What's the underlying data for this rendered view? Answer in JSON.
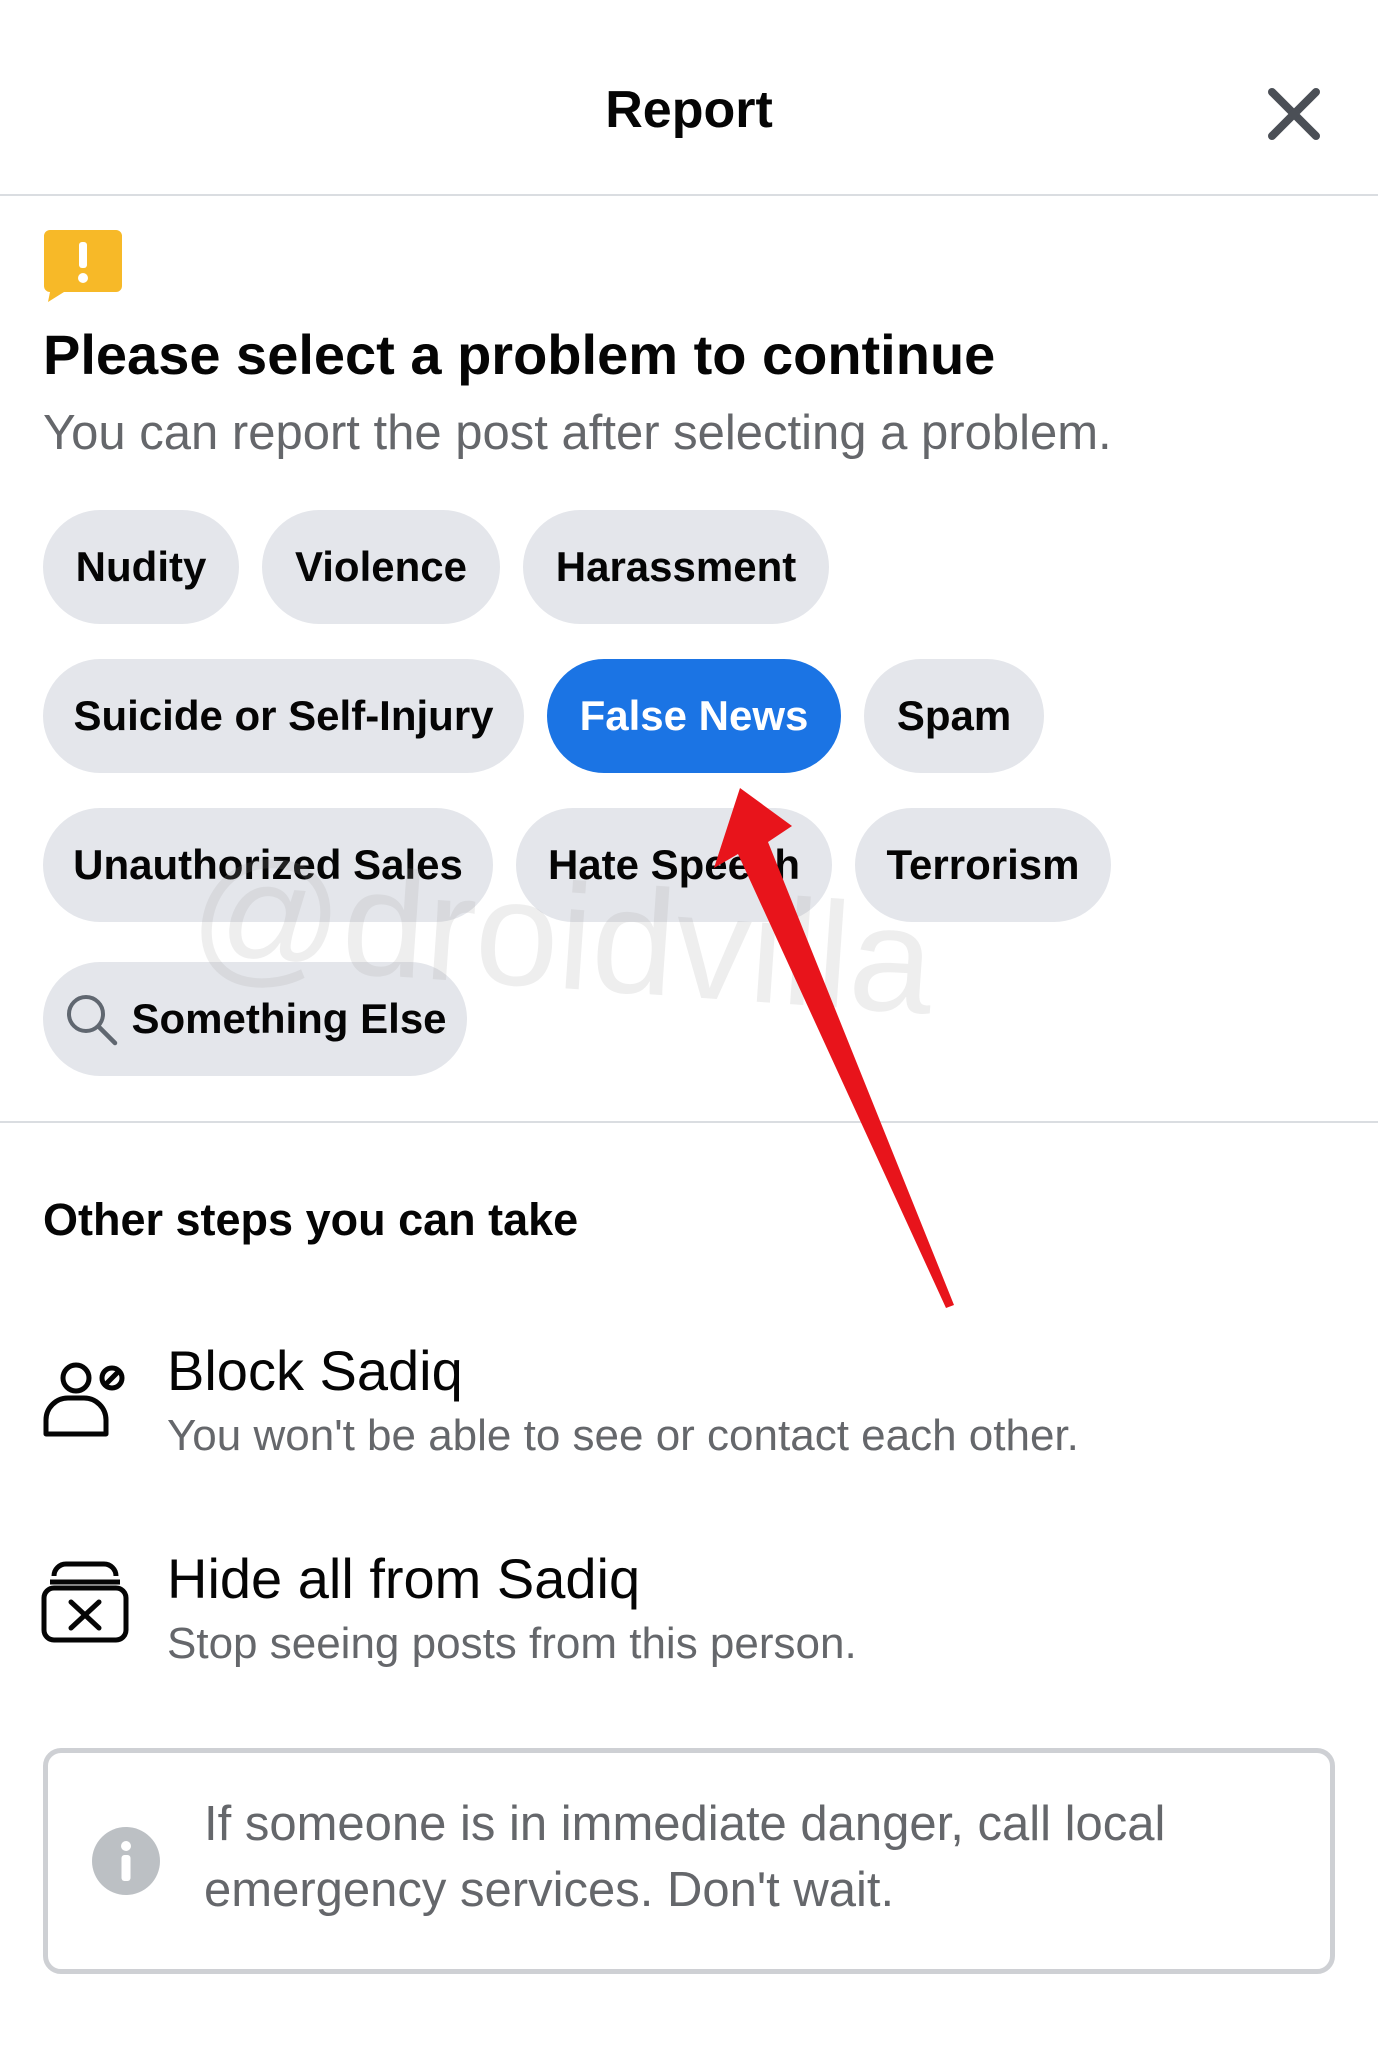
{
  "header": {
    "title": "Report",
    "close_icon": "close-icon"
  },
  "prompt": {
    "icon": "warning-flag-icon",
    "title": "Please select a problem to continue",
    "subtitle": "You can report the post after selecting a problem."
  },
  "problems": [
    {
      "label": "Nudity",
      "selected": false
    },
    {
      "label": "Violence",
      "selected": false
    },
    {
      "label": "Harassment",
      "selected": false
    },
    {
      "label": "Suicide or Self-Injury",
      "selected": false
    },
    {
      "label": "False News",
      "selected": true
    },
    {
      "label": "Spam",
      "selected": false
    },
    {
      "label": "Unauthorized Sales",
      "selected": false
    },
    {
      "label": "Hate Speech",
      "selected": false
    },
    {
      "label": "Terrorism",
      "selected": false
    },
    {
      "label": "Something Else",
      "selected": false,
      "icon": "search-icon"
    }
  ],
  "other_steps": {
    "heading": "Other steps you can take",
    "items": [
      {
        "icon": "block-user-icon",
        "title": "Block Sadiq",
        "subtitle": "You won't be able to see or contact each other."
      },
      {
        "icon": "hide-posts-icon",
        "title": "Hide all from Sadiq",
        "subtitle": "Stop seeing posts from this person."
      }
    ]
  },
  "notice": {
    "icon": "info-icon",
    "text": "If someone is in immediate danger, call local emergency services. Don't wait."
  },
  "watermark": "@droidvilla",
  "colors": {
    "selected_chip": "#1b74e4",
    "chip": "#e4e6eb",
    "warning": "#f7b928",
    "annotation_arrow": "#e8141b"
  }
}
